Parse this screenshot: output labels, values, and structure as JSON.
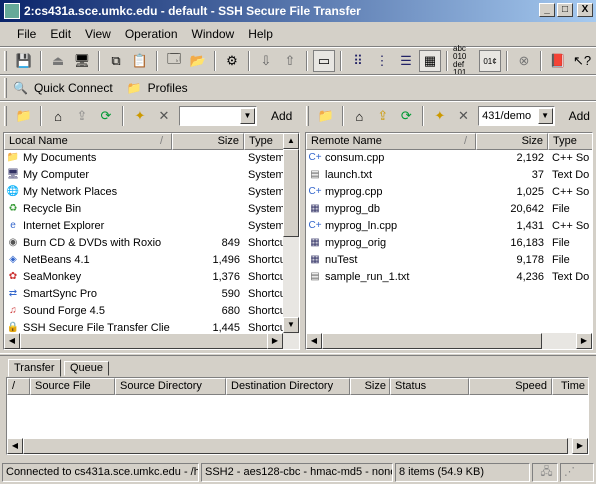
{
  "window": {
    "title": "2:cs431a.sce.umkc.edu - default - SSH Secure File Transfer",
    "min": "_",
    "max": "□",
    "close": "X"
  },
  "menu": [
    "File",
    "Edit",
    "View",
    "Operation",
    "Window",
    "Help"
  ],
  "quick": {
    "quick_connect": "Quick Connect",
    "profiles": "Profiles"
  },
  "local": {
    "path_value": "",
    "add_label": "Add",
    "headers": {
      "name": "Local Name",
      "size": "Size",
      "type": "Type"
    },
    "rows": [
      {
        "name": "My Documents",
        "size": "",
        "type": "System",
        "icon": "folder-icon"
      },
      {
        "name": "My Computer",
        "size": "",
        "type": "System",
        "icon": "computer-icon"
      },
      {
        "name": "My Network Places",
        "size": "",
        "type": "System",
        "icon": "network-icon"
      },
      {
        "name": "Recycle Bin",
        "size": "",
        "type": "System",
        "icon": "recycle-icon"
      },
      {
        "name": "Internet Explorer",
        "size": "",
        "type": "System",
        "icon": "ie-icon"
      },
      {
        "name": "Burn CD & DVDs with Roxio",
        "size": "849",
        "type": "Shortcu",
        "icon": "cd-icon"
      },
      {
        "name": "NetBeans 4.1",
        "size": "1,496",
        "type": "Shortcu",
        "icon": "netbeans-icon"
      },
      {
        "name": "SeaMonkey",
        "size": "1,376",
        "type": "Shortcu",
        "icon": "seamonkey-icon"
      },
      {
        "name": "SmartSync Pro",
        "size": "590",
        "type": "Shortcu",
        "icon": "sync-icon"
      },
      {
        "name": "Sound Forge 4.5",
        "size": "680",
        "type": "Shortcu",
        "icon": "sound-icon"
      },
      {
        "name": "SSH Secure File Transfer Client",
        "size": "1,445",
        "type": "Shortcu",
        "icon": "ssh-icon"
      }
    ]
  },
  "remote": {
    "path_value": "431/demo",
    "add_label": "Add",
    "headers": {
      "name": "Remote Name",
      "size": "Size",
      "type": "Type"
    },
    "rows": [
      {
        "name": "consum.cpp",
        "size": "2,192",
        "type": "C++ So",
        "icon": "cpp-file-icon"
      },
      {
        "name": "launch.txt",
        "size": "37",
        "type": "Text Do",
        "icon": "text-file-icon"
      },
      {
        "name": "myprog.cpp",
        "size": "1,025",
        "type": "C++ So",
        "icon": "cpp-file-icon"
      },
      {
        "name": "myprog_db",
        "size": "20,642",
        "type": "File",
        "icon": "binary-file-icon"
      },
      {
        "name": "myprog_ln.cpp",
        "size": "1,431",
        "type": "C++ So",
        "icon": "cpp-file-icon"
      },
      {
        "name": "myprog_orig",
        "size": "16,183",
        "type": "File",
        "icon": "binary-file-icon"
      },
      {
        "name": "nuTest",
        "size": "9,178",
        "type": "File",
        "icon": "binary-file-icon"
      },
      {
        "name": "sample_run_1.txt",
        "size": "4,236",
        "type": "Text Do",
        "icon": "text-file-icon"
      }
    ]
  },
  "transfer": {
    "tabs": [
      "Transfer",
      "Queue"
    ],
    "headers": {
      "sort": "/",
      "source_file": "Source File",
      "source_dir": "Source Directory",
      "dest_dir": "Destination Directory",
      "size": "Size",
      "status": "Status",
      "speed": "Speed",
      "time": "Time"
    }
  },
  "status": {
    "connection": "Connected to cs431a.sce.umkc.edu - /h",
    "cipher": "SSH2 - aes128-cbc - hmac-md5 - none",
    "items": "8 items (54.9 KB)"
  },
  "icons": {
    "sort_arrow": "/",
    "scroll_up": "▲",
    "scroll_down": "▼",
    "scroll_left": "◀",
    "scroll_right": "▶",
    "combo_arrow": "▼",
    "bits1": "abc 010",
    "bits2": "def 101"
  }
}
